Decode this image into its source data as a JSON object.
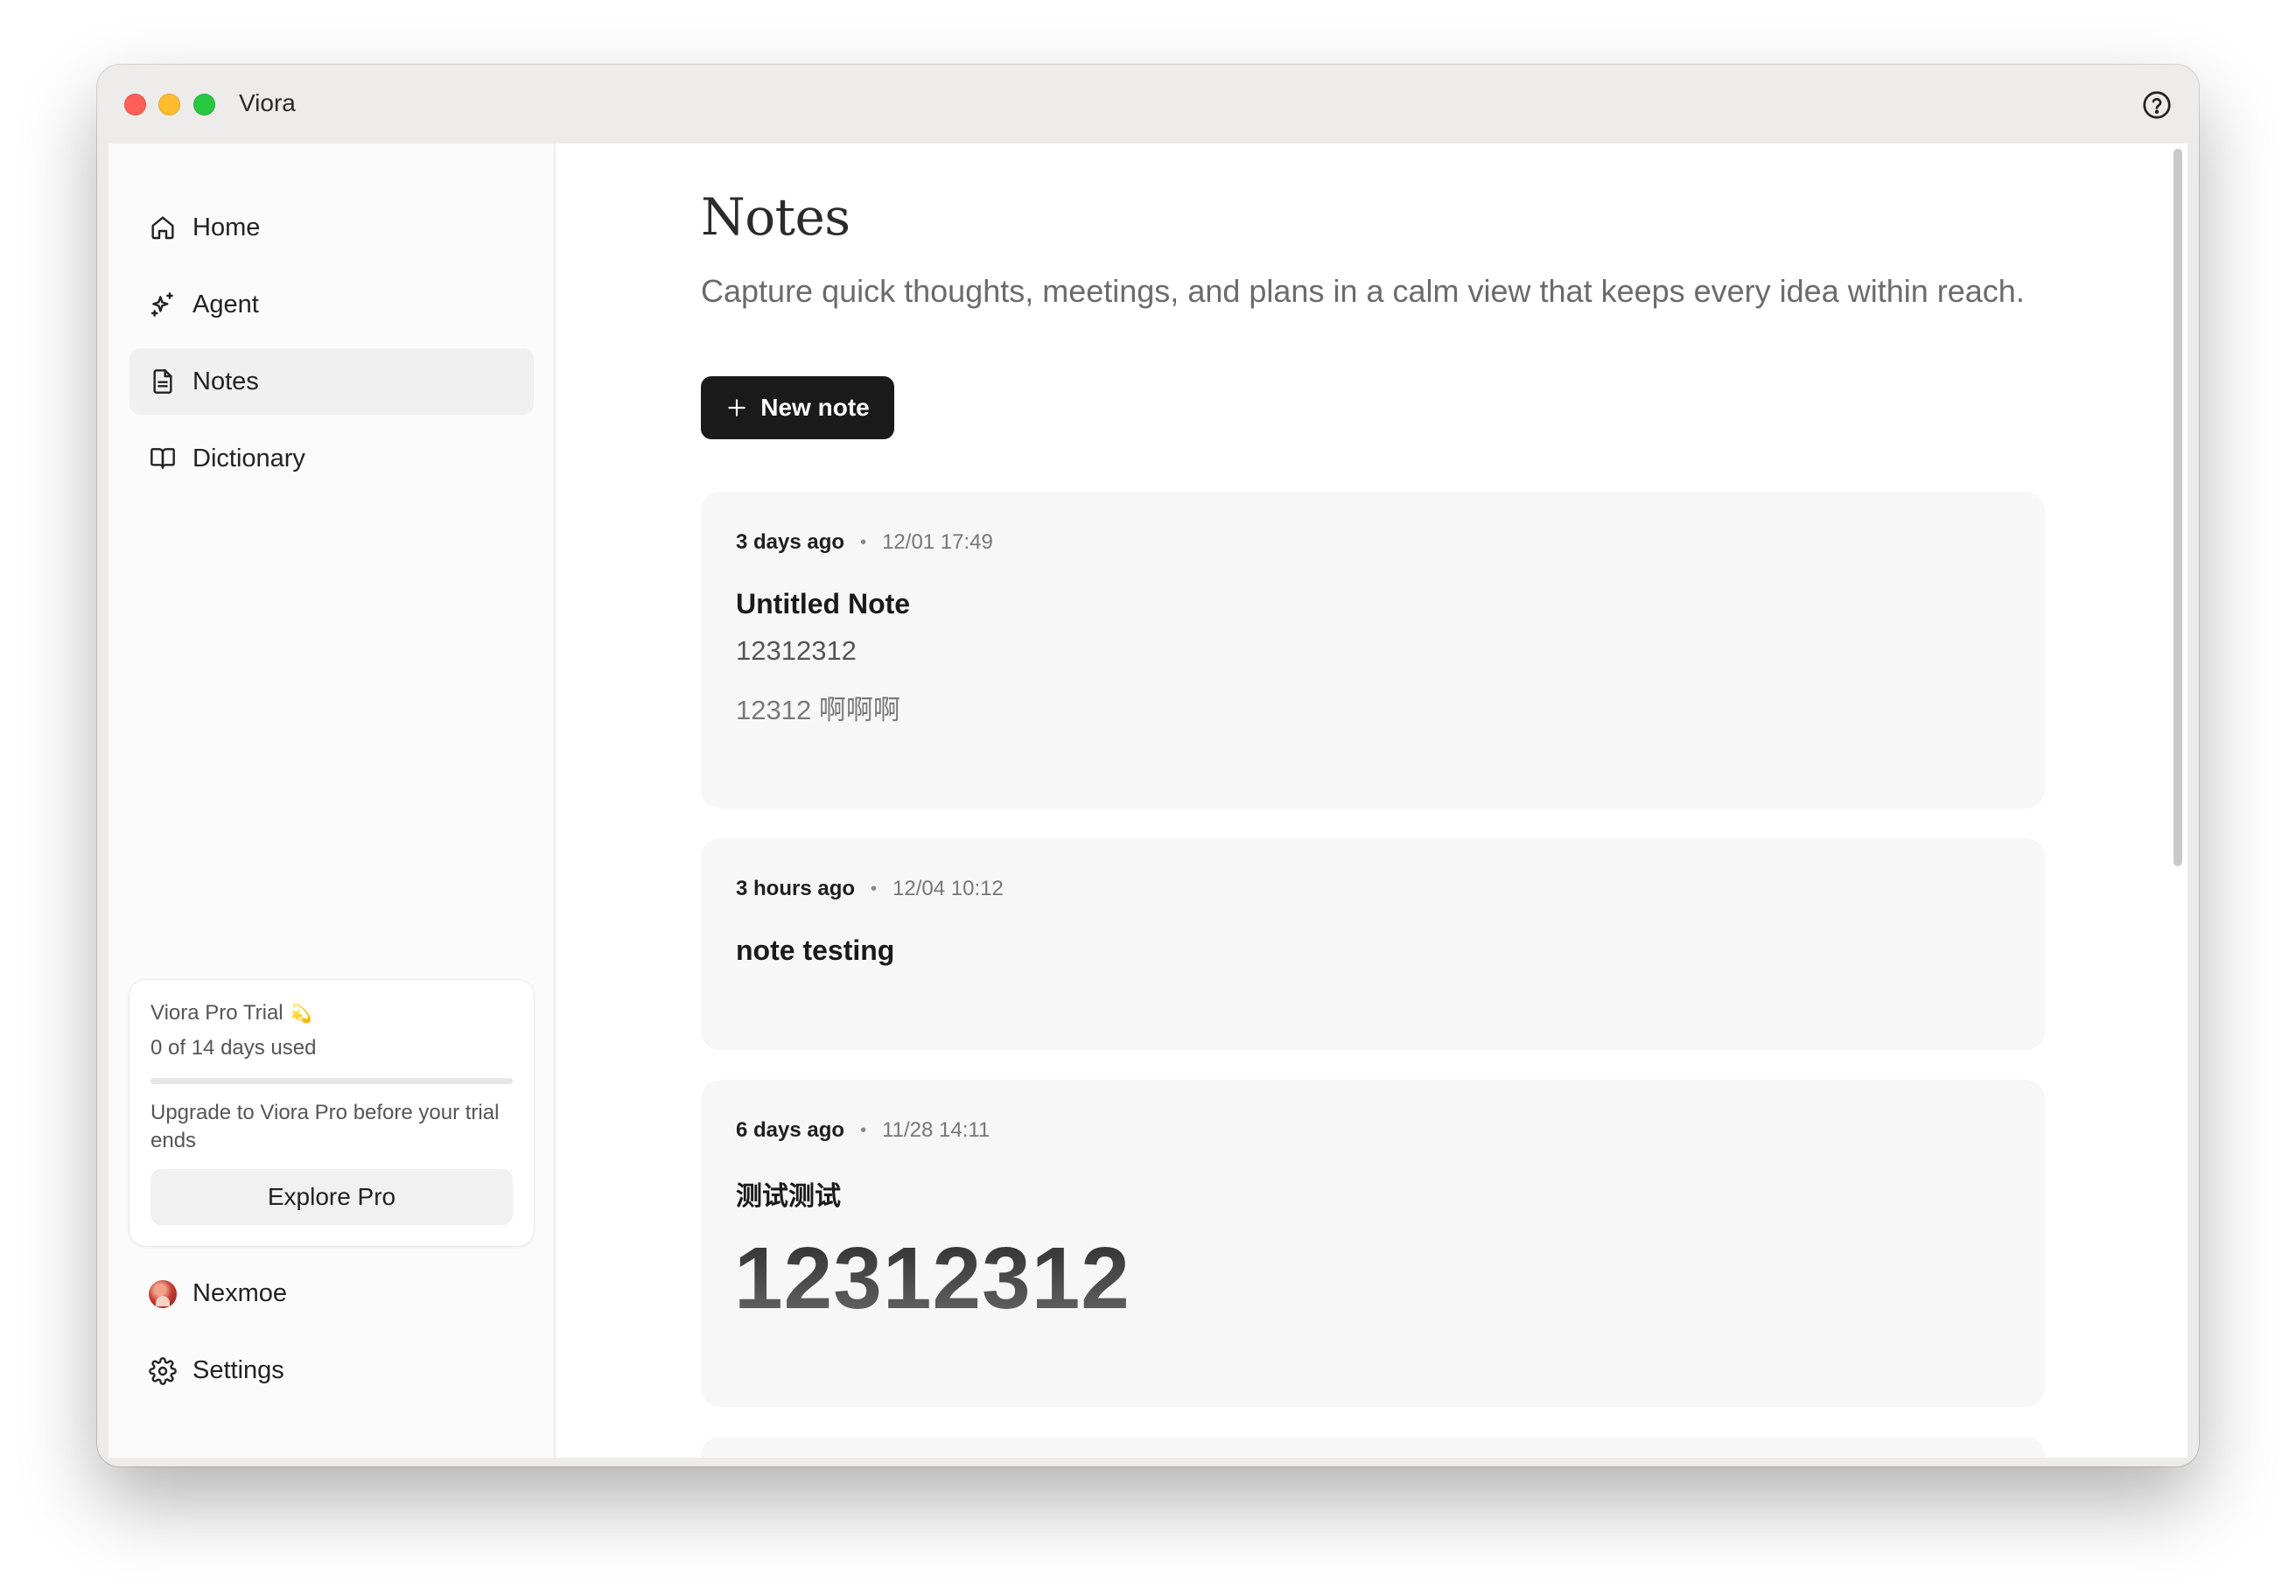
{
  "window": {
    "title": "Viora"
  },
  "sidebar": {
    "items": [
      {
        "label": "Home",
        "icon": "home-icon"
      },
      {
        "label": "Agent",
        "icon": "sparkles-icon"
      },
      {
        "label": "Notes",
        "icon": "document-icon",
        "active": true
      },
      {
        "label": "Dictionary",
        "icon": "book-icon"
      }
    ],
    "trial": {
      "title": "Viora Pro Trial",
      "title_emoji": "💫",
      "used": "0 of 14 days used",
      "progress_fraction": 0.0,
      "note": "Upgrade to Viora Pro before your trial ends",
      "button": "Explore Pro"
    },
    "user": {
      "name": "Nexmoe"
    },
    "settings": {
      "label": "Settings"
    }
  },
  "main": {
    "title": "Notes",
    "subtitle": "Capture quick thoughts, meetings, and plans in a calm view that keeps every idea within reach.",
    "new_note_label": "New note",
    "notes": [
      {
        "relative": "3 days ago",
        "date": "12/01 17:49",
        "title": "Untitled Note",
        "lines": [
          "12312312",
          "12312 啊啊啊"
        ]
      },
      {
        "relative": "3 hours ago",
        "date": "12/04 10:12",
        "title": "note testing",
        "lines": []
      },
      {
        "relative": "6 days ago",
        "date": "11/28 14:11",
        "title": "测试测试",
        "big": "12312312"
      }
    ]
  },
  "colors": {
    "accent_button": "#1a1a1a",
    "card_background": "#f7f7f7",
    "sidebar_active": "#f0f0f0",
    "traffic_red": "#fe5f57",
    "traffic_yellow": "#febc2e",
    "traffic_green": "#28c840"
  }
}
